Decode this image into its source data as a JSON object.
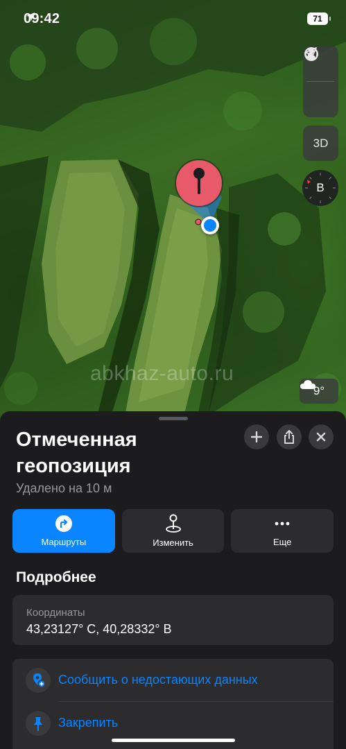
{
  "status_bar": {
    "time": "09:42",
    "battery": "71"
  },
  "map": {
    "controls": {
      "globe_icon": "globe-icon",
      "location_icon": "location-arrow-icon",
      "three_d_label": "3D",
      "compass_label": "В"
    },
    "weather": {
      "icon": "cloud-icon",
      "temperature": "9°"
    },
    "watermark": "abkhaz-auto.ru"
  },
  "sheet": {
    "title": "Отмеченная геопозиция",
    "subtitle": "Удалено на 10 м",
    "header_buttons": [
      "plus-icon",
      "share-icon",
      "close-icon"
    ],
    "actions": [
      {
        "label": "Маршруты",
        "icon": "directions-icon",
        "primary": true
      },
      {
        "label": "Изменить",
        "icon": "pin-edit-icon",
        "primary": false
      },
      {
        "label": "Еще",
        "icon": "more-icon",
        "primary": false
      }
    ],
    "details_title": "Подробнее",
    "coordinates": {
      "label": "Координаты",
      "value": "43,23127° С, 40,28332° В"
    },
    "list": [
      {
        "label": "Сообщить о недостающих данных",
        "icon": "report-icon"
      },
      {
        "label": "Закрепить",
        "icon": "pushpin-icon"
      }
    ]
  },
  "colors": {
    "accent": "#0a84ff",
    "sheet_background": "#1c1c1e",
    "card_background": "#2c2c2e",
    "pin_red": "#e8596a"
  }
}
